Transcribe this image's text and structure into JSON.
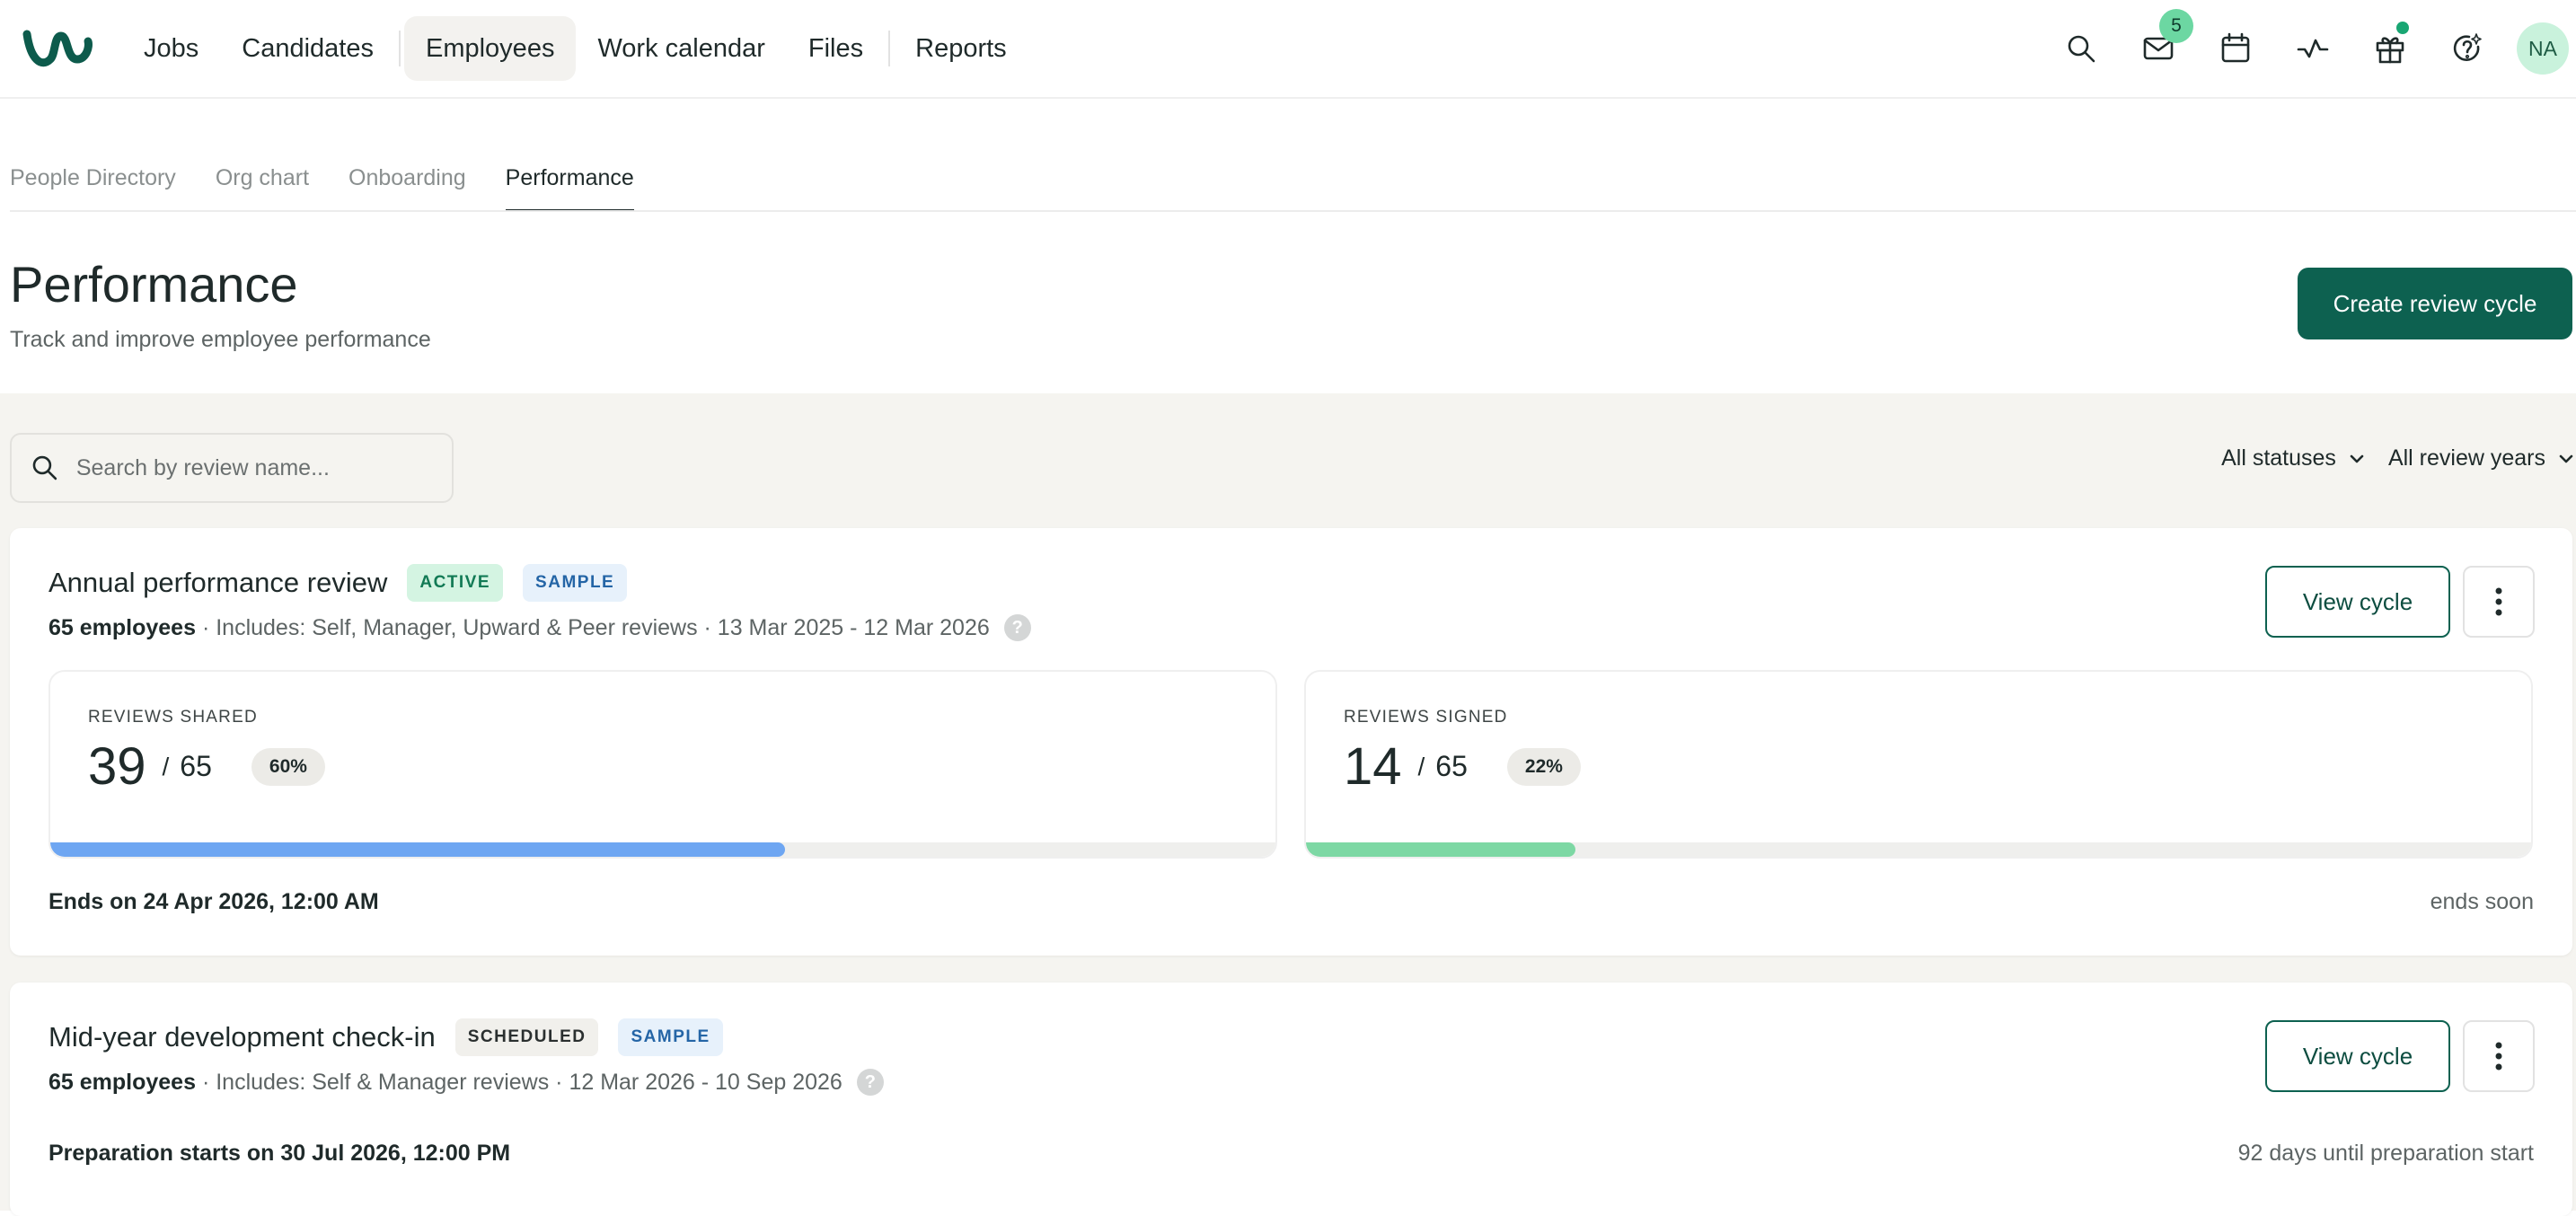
{
  "nav": {
    "items": [
      {
        "label": "Jobs",
        "active": false
      },
      {
        "label": "Candidates",
        "active": false
      },
      {
        "label": "Employees",
        "active": true
      },
      {
        "label": "Work calendar",
        "active": false
      },
      {
        "label": "Files",
        "active": false
      },
      {
        "label": "Reports",
        "active": false
      }
    ],
    "icons": [
      "search-icon",
      "mail-icon",
      "calendar-icon",
      "activity-icon",
      "gift-icon",
      "help-sparkle-icon"
    ],
    "mail_badge": "5",
    "avatar_initials": "NA"
  },
  "subtabs": [
    {
      "label": "People Directory",
      "active": false
    },
    {
      "label": "Org chart",
      "active": false
    },
    {
      "label": "Onboarding",
      "active": false
    },
    {
      "label": "Performance",
      "active": true
    }
  ],
  "header": {
    "title": "Performance",
    "subtitle": "Track and improve employee performance",
    "create_button": "Create review cycle"
  },
  "search": {
    "placeholder": "Search by review name..."
  },
  "filters": {
    "status": "All statuses",
    "years": "All review years"
  },
  "cycles": [
    {
      "title": "Annual performance review",
      "status_badge": "ACTIVE",
      "sample_badge": "SAMPLE",
      "employees": "65 employees",
      "meta": " · Includes: Self, Manager, Upward & Peer reviews · 13 Mar 2025 - 12 Mar 2026",
      "view_button": "View cycle",
      "stats": [
        {
          "label": "REVIEWS SHARED",
          "value": "39",
          "slash": "/",
          "total": "65",
          "percent_label": "60%",
          "fraction": 0.6,
          "color": "#6ea6f2"
        },
        {
          "label": "REVIEWS SIGNED",
          "value": "14",
          "slash": "/",
          "total": "65",
          "percent_label": "22%",
          "fraction": 0.22,
          "color": "#7dd8a4"
        }
      ],
      "footer_left": "Ends on 24 Apr 2026, 12:00 AM",
      "footer_right": "ends soon"
    },
    {
      "title": "Mid-year development check-in",
      "status_badge": "SCHEDULED",
      "sample_badge": "SAMPLE",
      "employees": "65 employees",
      "meta": " · Includes: Self & Manager reviews · 12 Mar 2026 - 10 Sep 2026",
      "view_button": "View cycle",
      "footer_left": "Preparation starts on 30 Jul 2026, 12:00 PM",
      "footer_right": "92 days until preparation start"
    }
  ],
  "colors": {
    "brand": "#0d6150",
    "active_badge_bg": "#d4f4e2",
    "sample_badge_bg": "#e7f1fb",
    "content_bg": "#f5f4f0"
  }
}
